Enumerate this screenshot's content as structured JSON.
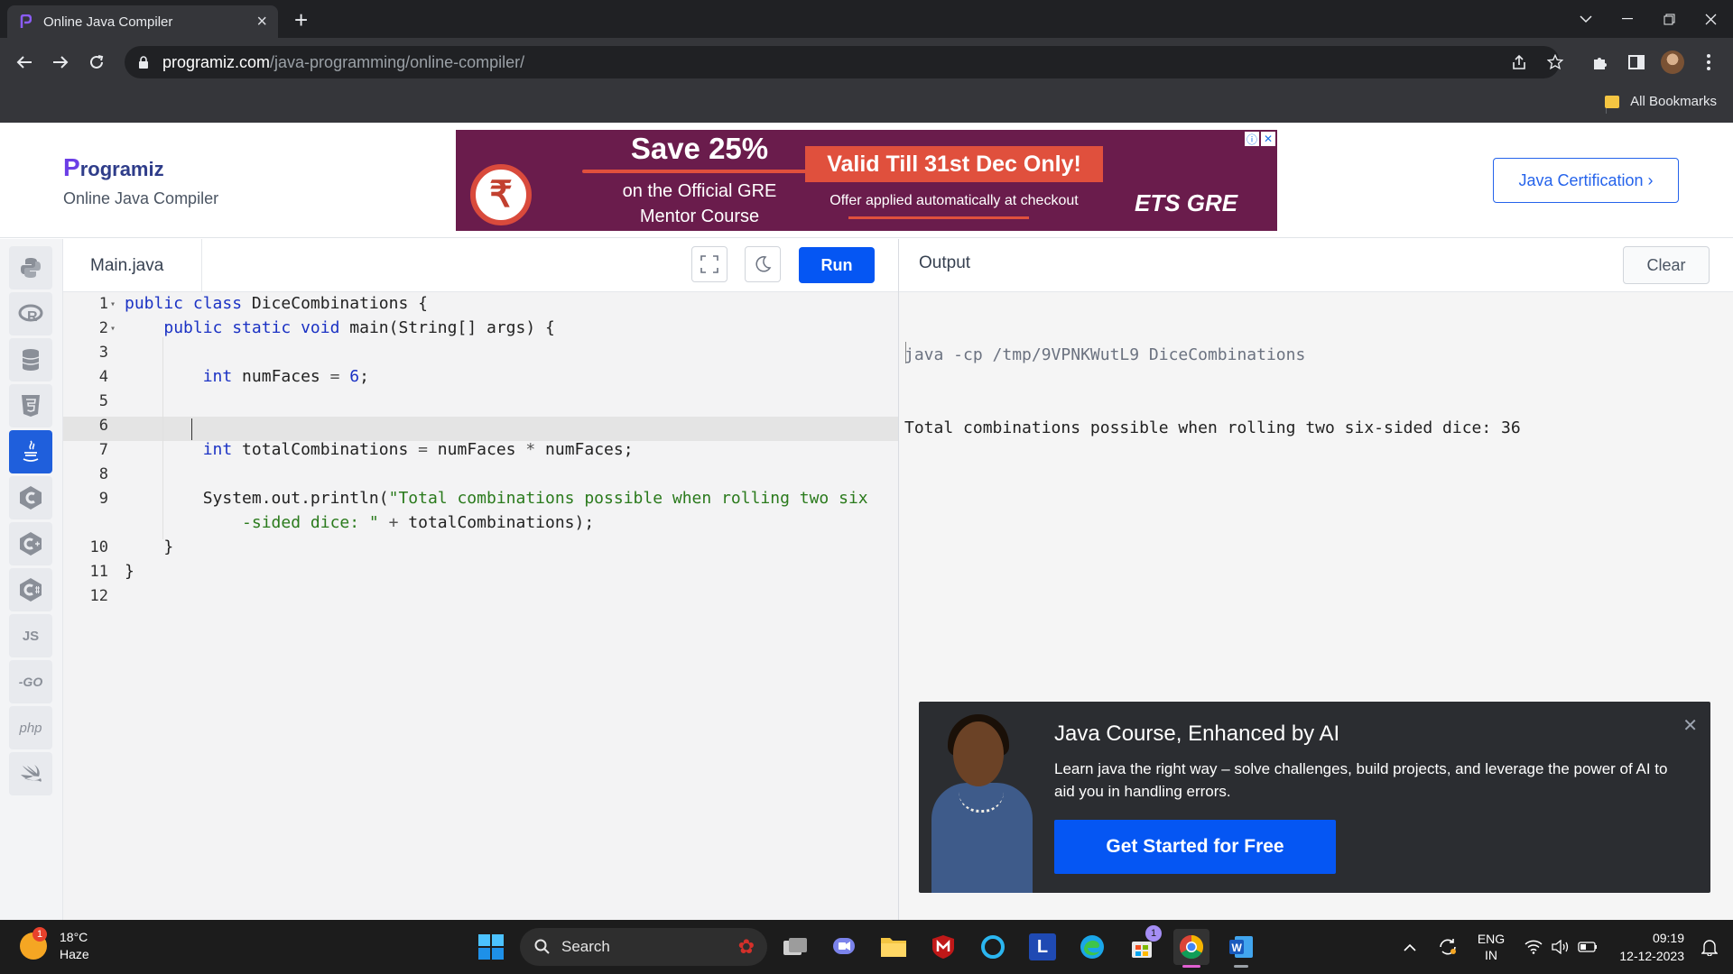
{
  "browser": {
    "tab_title": "Online Java Compiler",
    "url_host": "programiz.com",
    "url_path": "/java-programming/online-compiler/",
    "bookmarks_label": "All Bookmarks"
  },
  "site": {
    "logo_text": "rogramiz",
    "logo_p": "P",
    "subtitle": "Online Java Compiler",
    "cert_button": "Java Certification ›",
    "ad": {
      "headline": "Save 25%",
      "line1": "on the Official GRE",
      "line2": "Mentor Course",
      "valid": "Valid Till 31st Dec Only!",
      "offer": "Offer applied automatically at checkout",
      "brand": "ETS GRE",
      "rupee": "₹"
    }
  },
  "sidebar": {
    "languages": [
      "Python",
      "R",
      "SQL",
      "HTML",
      "Java",
      "C",
      "C++",
      "C#",
      "JS",
      "GO",
      "php",
      "Swift"
    ]
  },
  "editor": {
    "file_tab": "Main.java",
    "run_label": "Run",
    "line_numbers": [
      "1",
      "2",
      "3",
      "4",
      "5",
      "6",
      "7",
      "8",
      "9",
      "10",
      "11",
      "12"
    ]
  },
  "output": {
    "title": "Output",
    "clear_label": "Clear",
    "command": "java -cp /tmp/9VPNKWutL9 DiceCombinations",
    "result": "Total combinations possible when rolling two six-sided dice: 36"
  },
  "promo": {
    "title": "Java Course, Enhanced by AI",
    "description": "Learn java the right way – solve challenges, build projects, and leverage the power of AI to aid you in handling errors.",
    "cta": "Get Started for Free"
  },
  "taskbar": {
    "temperature": "18°C",
    "condition": "Haze",
    "weather_badge": "1",
    "search_label": "Search",
    "lang_line1": "ENG",
    "lang_line2": "IN",
    "time": "09:19",
    "date": "12-12-2023",
    "store_badge": "1"
  }
}
